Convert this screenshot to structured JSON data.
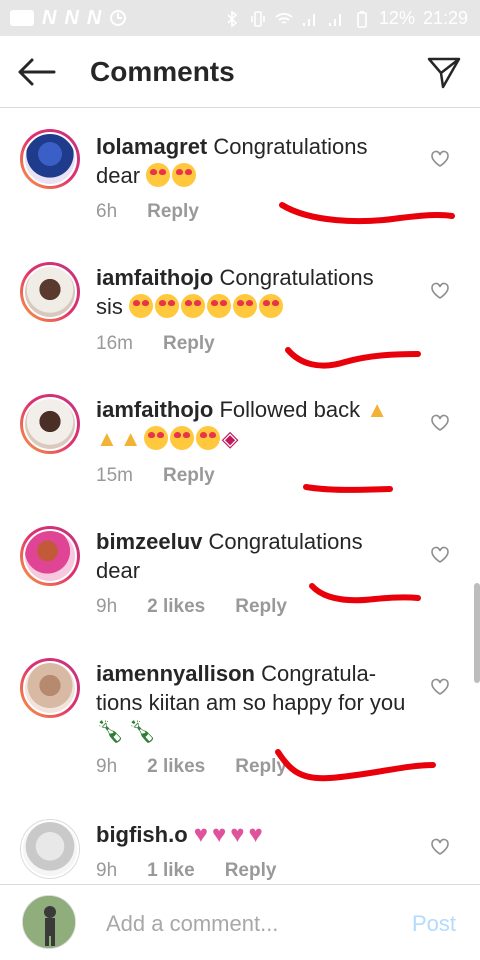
{
  "status_bar": {
    "carrier_icons": [
      "N",
      "N",
      "N"
    ],
    "battery": "12%",
    "time": "21:29"
  },
  "header": {
    "title": "Comments"
  },
  "comments": [
    {
      "username": "lolamagret",
      "text": "Congratulations dear",
      "emojis": "😍😍",
      "time": "6h",
      "likes": "",
      "reply": "Reply",
      "avatar_ring": true
    },
    {
      "username": "iamfaithojo",
      "text": "Congratulations sis",
      "emojis": "😍😍😍😍😍😍",
      "time": "16m",
      "likes": "",
      "reply": "Reply",
      "avatar_ring": true
    },
    {
      "username": "iamfaithojo",
      "text": "Followed back",
      "emojis": "🙏🙏🙏😍😍😍💋",
      "time": "15m",
      "likes": "",
      "reply": "Reply",
      "avatar_ring": true
    },
    {
      "username": "bimzeeluv",
      "text": "Congratulations dear",
      "emojis": "",
      "time": "9h",
      "likes": "2 likes",
      "reply": "Reply",
      "avatar_ring": true
    },
    {
      "username": "iamennyallison",
      "text": "Congratula-tions kiitan am so happy for you",
      "emojis": "🍾🍾",
      "time": "9h",
      "likes": "2 likes",
      "reply": "Reply",
      "avatar_ring": true
    },
    {
      "username": "bigfish.o",
      "text": "",
      "emojis": "💗💗💗💗",
      "time": "9h",
      "likes": "1 like",
      "reply": "Reply",
      "avatar_ring": false
    }
  ],
  "composer": {
    "placeholder": "Add a comment...",
    "post_label": "Post"
  },
  "colors": {
    "ring_gradient": [
      "#f9a03f",
      "#e1306c",
      "#c13584"
    ],
    "scribble": "#e8000b",
    "post_disabled": "#b3dbff",
    "meta_text": "#999999"
  }
}
